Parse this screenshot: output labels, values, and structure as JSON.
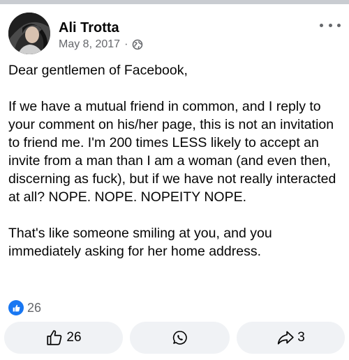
{
  "post": {
    "author": "Ali Trotta",
    "date": "May 8, 2017",
    "separator": "·",
    "privacy_icon": "globe-icon",
    "paragraphs": [
      "Dear gentlemen of Facebook,",
      "If we have a mutual friend in common, and I reply to your comment on his/her page, this is not an invitation to friend me. I'm 200 times LESS likely to accept an invite from a man than I am a woman (and even then, discerning as fuck), but if we have not really interacted at all? NOPE. NOPE. NOPEITY NOPE.",
      "That's like someone smiling at you, and you immediately asking for her home address."
    ]
  },
  "reactions": {
    "icon": "like-icon",
    "count": "26"
  },
  "actions": {
    "like_count": "26",
    "share_count": "3"
  },
  "colors": {
    "like_blue": "#1877f2",
    "secondary_text": "#65676b",
    "button_bg": "#f0f2f5",
    "top_strip": "#c9ccd1"
  }
}
